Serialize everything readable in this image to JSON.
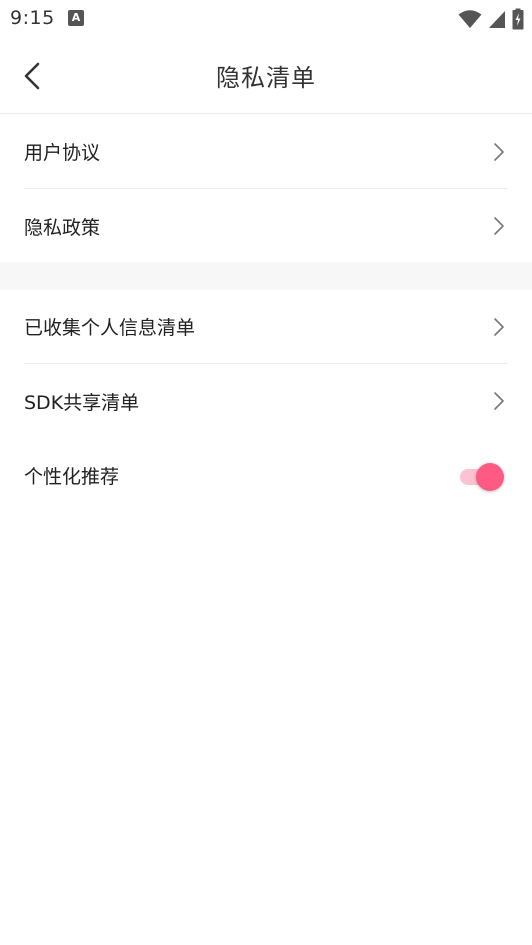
{
  "status_bar": {
    "time": "9:15",
    "notification_icon": "A"
  },
  "header": {
    "title": "隐私清单",
    "back_icon": "chevron-left-icon"
  },
  "group_1": {
    "items": [
      {
        "label": "用户协议",
        "icon": "chevron-right-icon"
      },
      {
        "label": "隐私政策",
        "icon": "chevron-right-icon"
      }
    ]
  },
  "group_2": {
    "items": [
      {
        "label": "已收集个人信息清单",
        "icon": "chevron-right-icon"
      },
      {
        "label": "SDK共享清单",
        "icon": "chevron-right-icon"
      }
    ],
    "toggle_item": {
      "label": "个性化推荐",
      "enabled": true
    }
  },
  "colors": {
    "accent": "#fe5a84",
    "accent_track": "#fbc3d2",
    "section_gap": "#f7f7f7"
  }
}
